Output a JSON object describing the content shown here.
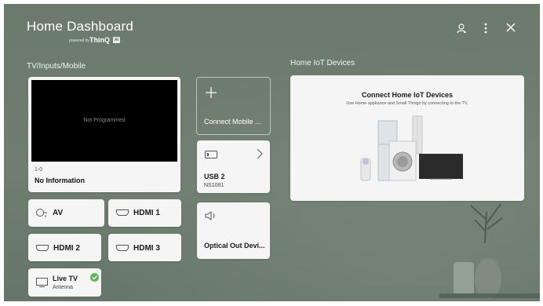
{
  "header": {
    "title": "Home Dashboard",
    "powered_by": "powered by",
    "brand": "ThinQ",
    "brand_badge": "AI",
    "icons": [
      "account-icon",
      "more-options-icon",
      "close-icon"
    ]
  },
  "sections": {
    "inputs_label": "TV/Inputs/Mobile",
    "iot_label": "Home IoT Devices"
  },
  "tv_card": {
    "screen_text": "Not Programmed",
    "channel": "1-0",
    "program": "No Information"
  },
  "connect_mobile": {
    "label": "Connect Mobile ..."
  },
  "usb": {
    "label": "USB 2",
    "sub": "NS1081"
  },
  "optical": {
    "label": "Optical Out Devi..."
  },
  "inputs": {
    "av": "AV",
    "hdmi1": "HDMI 1",
    "hdmi2": "HDMI 2",
    "hdmi3": "HDMI 3"
  },
  "live_tv": {
    "label": "Live TV",
    "sub": "Antenna"
  },
  "iot_card": {
    "title": "Connect Home IoT Devices",
    "subtitle": "Use Home appliance and Small Things by connecting to the TV."
  },
  "colors": {
    "background": "#6c7a6c",
    "card": "#f5f5f5",
    "check": "#5cb85c"
  }
}
